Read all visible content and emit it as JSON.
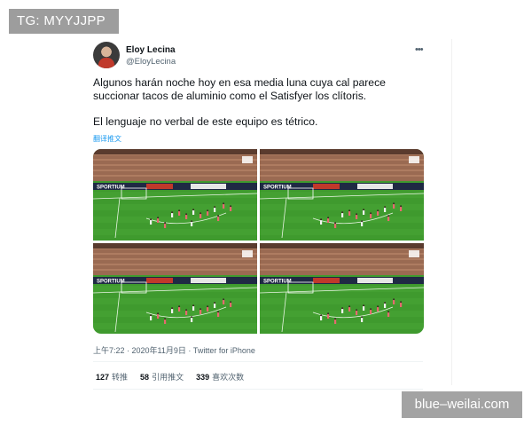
{
  "watermark_top": "TG: MYYJJPP",
  "watermark_bottom": "blue–weilai.com",
  "tweet": {
    "author_name": "Eloy Lecina",
    "author_handle": "@EloyLecina",
    "more_icon": "more-horizontal-icon",
    "text_line1": "Algunos harán noche hoy en esa media luna cuya cal parece succionar tacos de aluminio como el Satisfyer los clítoris.",
    "text_line2": "El lenguaje no verbal de este equipo es tétrico.",
    "translate_label": "翻译推文",
    "timestamp": "上午7:22 · 2020年11月9日 · Twitter for iPhone",
    "stats": [
      {
        "count": "127",
        "label": "转推"
      },
      {
        "count": "58",
        "label": "引用推文"
      },
      {
        "count": "339",
        "label": "喜欢次数"
      }
    ],
    "media_board_text": "SPORTIUM",
    "media_count": 4
  },
  "colors": {
    "pitch": "#3f9a2e",
    "stands": "#9a6a52",
    "link": "#1d9bf0",
    "watermark_bg": "#9d9d9d"
  }
}
